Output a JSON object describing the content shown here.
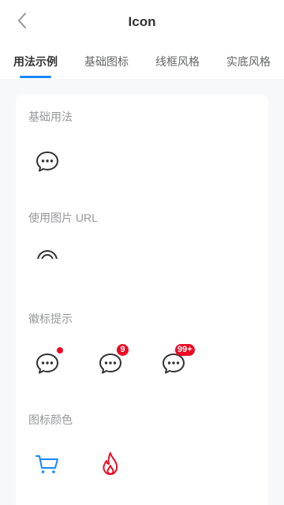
{
  "navbar": {
    "title": "Icon",
    "back_icon": "chevron-left-icon"
  },
  "tabs": {
    "active_color": "#1989fa",
    "items": [
      {
        "label": "用法示例",
        "active": true
      },
      {
        "label": "基础图标",
        "active": false
      },
      {
        "label": "线框风格",
        "active": false
      },
      {
        "label": "实底风格",
        "active": false
      }
    ]
  },
  "sections": {
    "basic": {
      "title": "基础用法",
      "icons": [
        "chat-o-icon"
      ]
    },
    "image": {
      "title": "使用图片 URL",
      "icons": [
        "image-url-icon"
      ]
    },
    "badge": {
      "title": "徽标提示",
      "items": [
        {
          "icon": "chat-o-icon",
          "badge": "",
          "dot": true
        },
        {
          "icon": "chat-o-icon",
          "badge": "9",
          "dot": false
        },
        {
          "icon": "chat-o-icon",
          "badge": "99+",
          "dot": false
        }
      ]
    },
    "color": {
      "title": "图标颜色",
      "items": [
        {
          "icon": "cart-o-icon",
          "color": "#1989fa"
        },
        {
          "icon": "fire-o-icon",
          "color": "#ee0a24"
        }
      ]
    }
  },
  "colors": {
    "badge": "#ee0a24",
    "text_primary": "#323233",
    "text_secondary": "#969799"
  }
}
